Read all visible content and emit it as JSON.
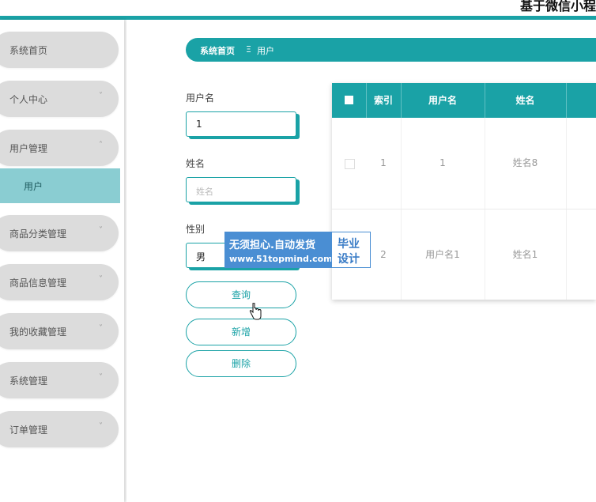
{
  "header": {
    "title": "基于微信小程"
  },
  "sidebar": {
    "items": [
      {
        "label": "系统首页",
        "chevron": ""
      },
      {
        "label": "个人中心",
        "chevron": "˅"
      },
      {
        "label": "用户管理",
        "chevron": "˄"
      },
      {
        "label": "商品分类管理",
        "chevron": "˅"
      },
      {
        "label": "商品信息管理",
        "chevron": "˅"
      },
      {
        "label": "我的收藏管理",
        "chevron": "˅"
      },
      {
        "label": "系统管理",
        "chevron": "˅"
      },
      {
        "label": "订单管理",
        "chevron": "˅"
      }
    ],
    "submenu": {
      "label": "用户"
    }
  },
  "breadcrumb": {
    "home": "系统首页",
    "separator": "Ξ",
    "current": "用户"
  },
  "search": {
    "username_label": "用户名",
    "username_value": "1",
    "name_label": "姓名",
    "name_placeholder": "姓名",
    "gender_label": "性别",
    "gender_value": "男",
    "query_button": "查询",
    "add_button": "新增",
    "delete_button": "删除"
  },
  "table": {
    "headers": [
      "索引",
      "用户名",
      "姓名"
    ],
    "rows": [
      {
        "index": "1",
        "username": "1",
        "name": "姓名8"
      },
      {
        "index": "2",
        "username": "用户名1",
        "name": "姓名1"
      }
    ]
  },
  "watermark": {
    "line1": "无须担心.自动发货",
    "line2": "www.51topmind.com",
    "badge1": "毕业",
    "badge2": "设计"
  },
  "colors": {
    "accent": "#1aa2a6",
    "submenu": "#8acdd2",
    "watermark": "#4a8ed3"
  }
}
